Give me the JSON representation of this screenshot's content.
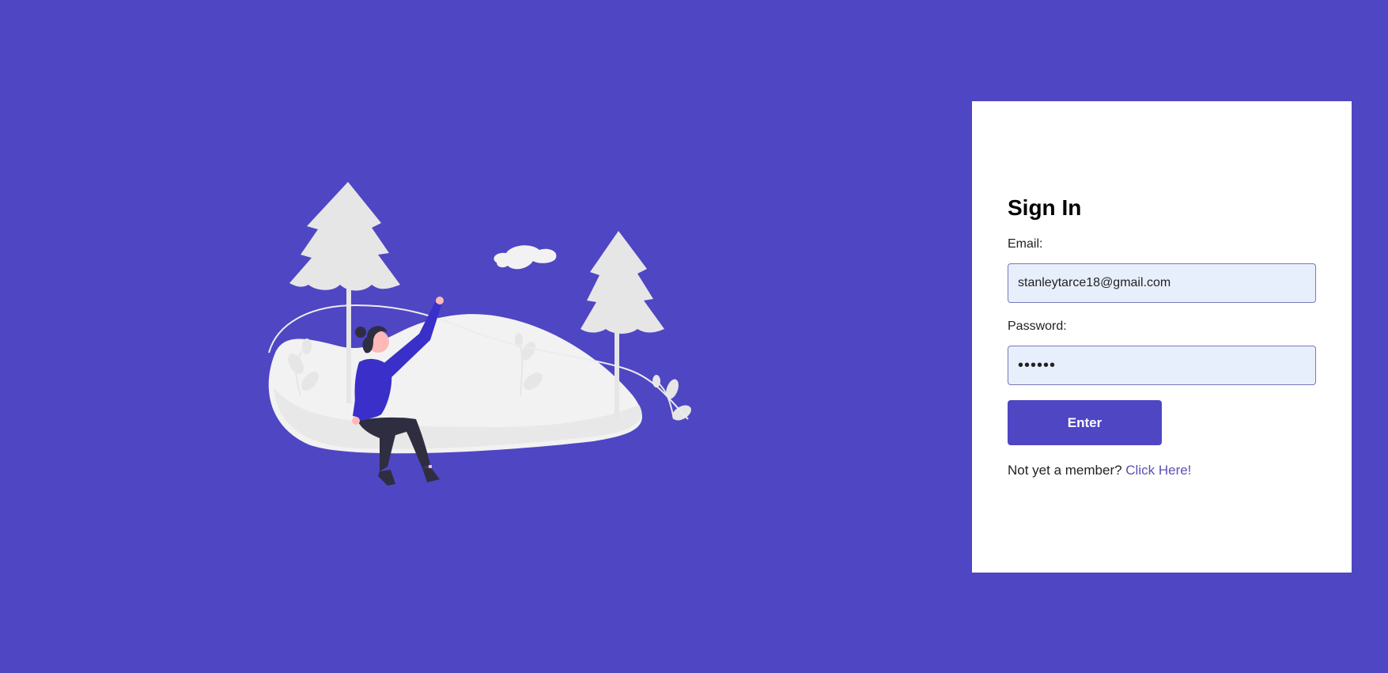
{
  "colors": {
    "background": "#4f46c4",
    "card_background": "#ffffff",
    "input_background": "#e8effc",
    "button": "#4f46c4",
    "link": "#5a4fb5",
    "illustration_light": "#e6e6e6",
    "illustration_lighter": "#f2f2f2",
    "person_shirt": "#3a2fc9",
    "person_pants": "#2f2e41",
    "skin": "#ffb8b8"
  },
  "illustration": {
    "icon": "landscape-person-swing-illustration"
  },
  "signin": {
    "title": "Sign In",
    "email_label": "Email:",
    "email_value": "stanleytarce18@gmail.com",
    "password_label": "Password:",
    "password_value": "••••••",
    "enter_label": "Enter",
    "signup_prompt": "Not yet a member? ",
    "signup_link": "Click Here!"
  }
}
